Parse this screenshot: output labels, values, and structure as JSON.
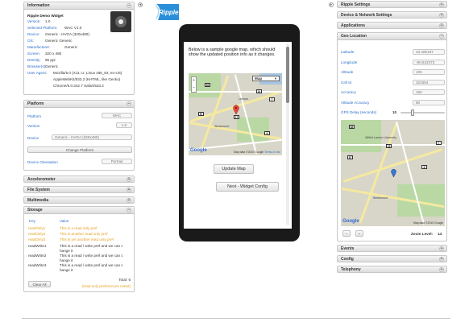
{
  "brand": {
    "logo_text": "Ripple"
  },
  "left": {
    "information": {
      "title": "Information",
      "widget_name": "Ripple Demo Widget",
      "rows": [
        {
          "label": "Version:",
          "value": "1.0"
        },
        {
          "label": "Selected Platform:",
          "value": "WAC V1.0"
        },
        {
          "label": "Device:",
          "value": "Generic - HVGA (320x480)"
        },
        {
          "label": "OS:",
          "value": "Generic Generic"
        },
        {
          "label": "Manufacturer:",
          "value": "Generic"
        },
        {
          "label": "Screen:",
          "value": "320 x 480"
        },
        {
          "label": "Density:",
          "value": "96 ppi"
        },
        {
          "label": "Browser(s):",
          "value": "Generic"
        },
        {
          "label": "User Agent:",
          "value": "Mozilla/5.0 (X11; U; Linux x86_64; en-US) AppleWebKit/533.2 (KHTML, like Gecko) Chrome/5.0.342.7 Safari/533.2"
        }
      ],
      "user_agent_lines": [
        "Mozilla/5.0 (X11; U; Linux x86_64; en-US)",
        "AppleWebKit/533.2 (KHTML, like Gecko)",
        "Chrome/5.0.342.7 Safari/533.2"
      ]
    },
    "platform": {
      "title": "Platform",
      "platform_label": "Platform",
      "platform_value": "WAC",
      "version_label": "Version",
      "version_value": "1.0",
      "device_label": "Device",
      "device_value": "Generic - HVGA (320x480)",
      "change_button": "Change Platform",
      "orientation_label": "Device Orientation",
      "orientation_value": "Portrait"
    },
    "accelerometer": "Accelerometer",
    "file_system": "File System",
    "multimedia": "Multimedia",
    "storage": {
      "title": "Storage",
      "col_key": "Key",
      "col_value": "Value",
      "rows": [
        {
          "key": "readOnly1",
          "value": "This is a read only pref",
          "readonly": true
        },
        {
          "key": "readOnly2",
          "value": "This is another read only pref",
          "readonly": true
        },
        {
          "key": "readOnly3",
          "value": "This is yet another read only pref",
          "readonly": true
        },
        {
          "key": "readWrite1",
          "value": "This is a read / write pref and we can change it",
          "readonly": false
        },
        {
          "key": "readWrite2",
          "value": "This is a read / write pref and we can change it",
          "readonly": false
        },
        {
          "key": "readWrite3",
          "value": "This is a read / write pref and we can change it",
          "readonly": false
        }
      ],
      "value_lines": [
        [
          "This is a read only pref"
        ],
        [
          "This is another read only pref"
        ],
        [
          "This is yet another read only pref"
        ],
        [
          "This is a read / write pref and we can c",
          "hange it"
        ],
        [
          "This is a read / write pref and we can c",
          "hange it"
        ],
        [
          "This is a read / write pref and we can c",
          "hange it"
        ]
      ],
      "total": "Total: 6",
      "clear_button": "Clear All",
      "note": "(read-only preferences noted)"
    }
  },
  "phone": {
    "message": "Below is a sample google map, which should show the updated position info as it changes.",
    "map_type": "Map",
    "map_data_text": "Map data ©2010 Google",
    "terms": "Terms of Use",
    "update_button": "Update Map",
    "next_button": "Next - Widget Config"
  },
  "right": {
    "ripple_settings": "Ripple Settings",
    "device_network": "Device & Network Settings",
    "applications": "Applications",
    "geo": {
      "title": "Geo Location",
      "fields": [
        {
          "label": "Latitude",
          "value": "43.465187"
        },
        {
          "label": "Longitude",
          "value": "-80.522372"
        },
        {
          "label": "Altitude",
          "value": "100"
        },
        {
          "label": "Cell Id",
          "value": "321654"
        },
        {
          "label": "Accuracy",
          "value": "150"
        },
        {
          "label": "Altitude Accuracy",
          "value": "80"
        }
      ],
      "gps_label": "GPS Delay (seconds)",
      "gps_value": "10",
      "gps_fraction": 0.25,
      "map_data_text": "Map data ©2010 Google",
      "zoom_label": "Zoom Level:",
      "zoom_value": "14"
    },
    "events": "Events",
    "config": "Config",
    "telephony": "Telephony"
  }
}
